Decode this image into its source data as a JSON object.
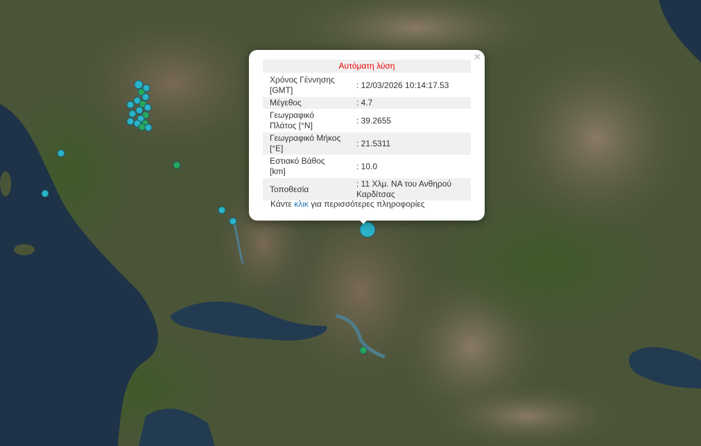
{
  "popup": {
    "title": "Αυτόματη λύση",
    "close_label": "×",
    "rows": [
      {
        "label": "Χρόνος Γέννησης [GMT]",
        "value": ": 12/03/2026 10:14:17.53"
      },
      {
        "label": "Μέγεθος",
        "value": ": 4.7"
      },
      {
        "label": "Γεωγραφικό Πλάτος [°N]",
        "value": ": 39.2655"
      },
      {
        "label": "Γεωγραφικό Μήκος [°E]",
        "value": ": 21.5311"
      },
      {
        "label": "Εστιακό Βάθος [km]",
        "value": ": 10.0"
      },
      {
        "label": "Τοποθεσία",
        "value": ": 11 Χλμ. ΝΑ του Ανθηρού Καρδίτσας"
      }
    ],
    "more_prefix": "Κάντε",
    "more_link": "κλικ",
    "more_suffix": "για περισσότερες πληροφορίες"
  },
  "colors": {
    "marker_cyan": "#2bb3c8",
    "marker_green": "#27a85a",
    "accent_red": "#e00000",
    "link_blue": "#1a73b8"
  }
}
